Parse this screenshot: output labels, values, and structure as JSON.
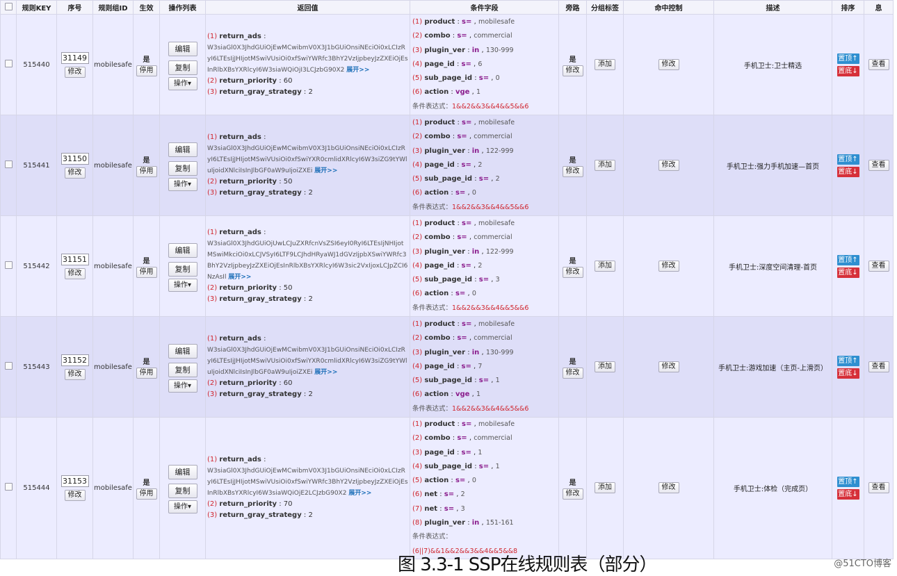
{
  "headers": [
    "",
    "规则KEY",
    "序号",
    "规则组ID",
    "生效",
    "操作列表",
    "返回值",
    "条件字段",
    "旁路",
    "分组标签",
    "命中控制",
    "描述",
    "排序",
    "息"
  ],
  "labels": {
    "modify": "修改",
    "effective": "是",
    "disable": "停用",
    "edit": "编辑",
    "copy": "复制",
    "ops": "操作▾",
    "bypass": "是",
    "add": "添加",
    "hit_modify": "修改",
    "top": "置顶↑",
    "bottom": "置底↓",
    "view": "查看",
    "expand": "展开>>",
    "expr_label": "条件表达式："
  },
  "rows": [
    {
      "key": "515440",
      "seq": "31149",
      "group": "mobilesafe",
      "returns": [
        {
          "n": "(1)",
          "k": "return_ads",
          "v": " :"
        },
        {
          "n": "(2)",
          "k": "return_priority",
          "v": " : 60"
        },
        {
          "n": "(3)",
          "k": "return_gray_strategy",
          "v": " : 2"
        }
      ],
      "code": "W3siaGl0X3JhdGUiOjEwMCwibmV0X3J1bGUiOnsiNEciOi0xLCIzRyI6LTEsIjJHIjotMSwiVUsiOi0xfSwiYWRfc3BhY2VzIjpbeyJzZXEiOjEsInRlbXBsYXRlcyI6W3siaWQiOjI3LCJzbG90X2",
      "conds": [
        {
          "n": "(1)",
          "k": "product",
          "op": "s=",
          "v": "mobilesafe"
        },
        {
          "n": "(2)",
          "k": "combo",
          "op": "s=",
          "v": "commercial"
        },
        {
          "n": "(3)",
          "k": "plugin_ver",
          "op": "in",
          "v": "130-999"
        },
        {
          "n": "(4)",
          "k": "page_id",
          "op": "s=",
          "v": "6"
        },
        {
          "n": "(5)",
          "k": "sub_page_id",
          "op": "s=",
          "v": "0"
        },
        {
          "n": "(6)",
          "k": "action",
          "op": "vge",
          "v": "1"
        }
      ],
      "expr": "1&&2&&3&&4&&5&&6",
      "desc": "手机卫士:卫士精选"
    },
    {
      "key": "515441",
      "seq": "31150",
      "group": "mobilesafe",
      "returns": [
        {
          "n": "(1)",
          "k": "return_ads",
          "v": " :"
        },
        {
          "n": "(2)",
          "k": "return_priority",
          "v": " : 50"
        },
        {
          "n": "(3)",
          "k": "return_gray_strategy",
          "v": " : 2"
        }
      ],
      "code": "W3siaGl0X3JhdGUiOjEwMCwibmV0X3J1bGUiOnsiNEciOi0xLCIzRyI6LTEsIjJHIjotMSwiVUsiOi0xfSwiYXR0cmlidXRlcyI6W3siZG9tYWluIjoidXNlciIsInJlbGF0aW9uIjoiZXEi",
      "conds": [
        {
          "n": "(1)",
          "k": "product",
          "op": "s=",
          "v": "mobilesafe"
        },
        {
          "n": "(2)",
          "k": "combo",
          "op": "s=",
          "v": "commercial"
        },
        {
          "n": "(3)",
          "k": "plugin_ver",
          "op": "in",
          "v": "122-999"
        },
        {
          "n": "(4)",
          "k": "page_id",
          "op": "s=",
          "v": "2"
        },
        {
          "n": "(5)",
          "k": "sub_page_id",
          "op": "s=",
          "v": "2"
        },
        {
          "n": "(6)",
          "k": "action",
          "op": "s=",
          "v": "0"
        }
      ],
      "expr": "1&&2&&3&&4&&5&&6",
      "desc": "手机卫士:强力手机加速—首页"
    },
    {
      "key": "515442",
      "seq": "31151",
      "group": "mobilesafe",
      "returns": [
        {
          "n": "(1)",
          "k": "return_ads",
          "v": " :"
        },
        {
          "n": "(2)",
          "k": "return_priority",
          "v": " : 50"
        },
        {
          "n": "(3)",
          "k": "return_gray_strategy",
          "v": " : 2"
        }
      ],
      "code": "W3siaGl0X3JhdGUiOjUwLCJuZXRfcnVsZSI6eyI0RyI6LTEsIjNHIjotMSwiMkciOi0xLCJVSyI6LTF9LCJhdHRyaWJ1dGVzIjpbXSwiYWRfc3BhY2VzIjpbeyJzZXEiOjEsInRlbXBsYXRlcyI6W3sic2VxIjoxLCJpZCI6NzAsIl",
      "conds": [
        {
          "n": "(1)",
          "k": "product",
          "op": "s=",
          "v": "mobilesafe"
        },
        {
          "n": "(2)",
          "k": "combo",
          "op": "s=",
          "v": "commercial"
        },
        {
          "n": "(3)",
          "k": "plugin_ver",
          "op": "in",
          "v": "122-999"
        },
        {
          "n": "(4)",
          "k": "page_id",
          "op": "s=",
          "v": "2"
        },
        {
          "n": "(5)",
          "k": "sub_page_id",
          "op": "s=",
          "v": "3"
        },
        {
          "n": "(6)",
          "k": "action",
          "op": "s=",
          "v": "0"
        }
      ],
      "expr": "1&&2&&3&&4&&5&&6",
      "desc": "手机卫士:深度空间清理-首页"
    },
    {
      "key": "515443",
      "seq": "31152",
      "group": "mobilesafe",
      "returns": [
        {
          "n": "(1)",
          "k": "return_ads",
          "v": " :"
        },
        {
          "n": "(2)",
          "k": "return_priority",
          "v": " : 60"
        },
        {
          "n": "(3)",
          "k": "return_gray_strategy",
          "v": " : 2"
        }
      ],
      "code": "W3siaGl0X3JhdGUiOjEwMCwibmV0X3J1bGUiOnsiNEciOi0xLCIzRyI6LTEsIjJHIjotMSwiVUsiOi0xfSwiYXR0cmlidXRlcyI6W3siZG9tYWluIjoidXNlciIsInJlbGF0aW9uIjoiZXEi",
      "conds": [
        {
          "n": "(1)",
          "k": "product",
          "op": "s=",
          "v": "mobilesafe"
        },
        {
          "n": "(2)",
          "k": "combo",
          "op": "s=",
          "v": "commercial"
        },
        {
          "n": "(3)",
          "k": "plugin_ver",
          "op": "in",
          "v": "130-999"
        },
        {
          "n": "(4)",
          "k": "page_id",
          "op": "s=",
          "v": "7"
        },
        {
          "n": "(5)",
          "k": "sub_page_id",
          "op": "s=",
          "v": "1"
        },
        {
          "n": "(6)",
          "k": "action",
          "op": "vge",
          "v": "1"
        }
      ],
      "expr": "1&&2&&3&&4&&5&&6",
      "desc": "手机卫士:游戏加速（主页-上滑页）"
    },
    {
      "key": "515444",
      "seq": "31153",
      "group": "mobilesafe",
      "returns": [
        {
          "n": "(1)",
          "k": "return_ads",
          "v": " :"
        },
        {
          "n": "(2)",
          "k": "return_priority",
          "v": " : 70"
        },
        {
          "n": "(3)",
          "k": "return_gray_strategy",
          "v": " : 2"
        }
      ],
      "code": "W3siaGl0X3JhdGUiOjEwMCwibmV0X3J1bGUiOnsiNEciOi0xLCIzRyI6LTEsIjJHIjotMSwiVUsiOi0xfSwiYWRfc3BhY2VzIjpbeyJzZXEiOjEsInRlbXBsYXRlcyI6W3siaWQiOjE2LCJzbG90X2",
      "conds": [
        {
          "n": "(1)",
          "k": "product",
          "op": "s=",
          "v": "mobilesafe"
        },
        {
          "n": "(2)",
          "k": "combo",
          "op": "s=",
          "v": "commercial"
        },
        {
          "n": "(3)",
          "k": "page_id",
          "op": "s=",
          "v": "1"
        },
        {
          "n": "(4)",
          "k": "sub_page_id",
          "op": "s=",
          "v": "1"
        },
        {
          "n": "(5)",
          "k": "action",
          "op": "s=",
          "v": "0"
        },
        {
          "n": "(6)",
          "k": "net",
          "op": "s=",
          "v": "2"
        },
        {
          "n": "(7)",
          "k": "net",
          "op": "s=",
          "v": "3"
        },
        {
          "n": "(8)",
          "k": "plugin_ver",
          "op": "in",
          "v": "151-161"
        }
      ],
      "expr": "(6||7)&&1&&2&&3&&4&&5&&8",
      "desc": "手机卫士:体检（完成页）"
    }
  ],
  "caption": "图 3.3-1 SSP在线规则表（部分）",
  "watermark": "@51CTO博客"
}
